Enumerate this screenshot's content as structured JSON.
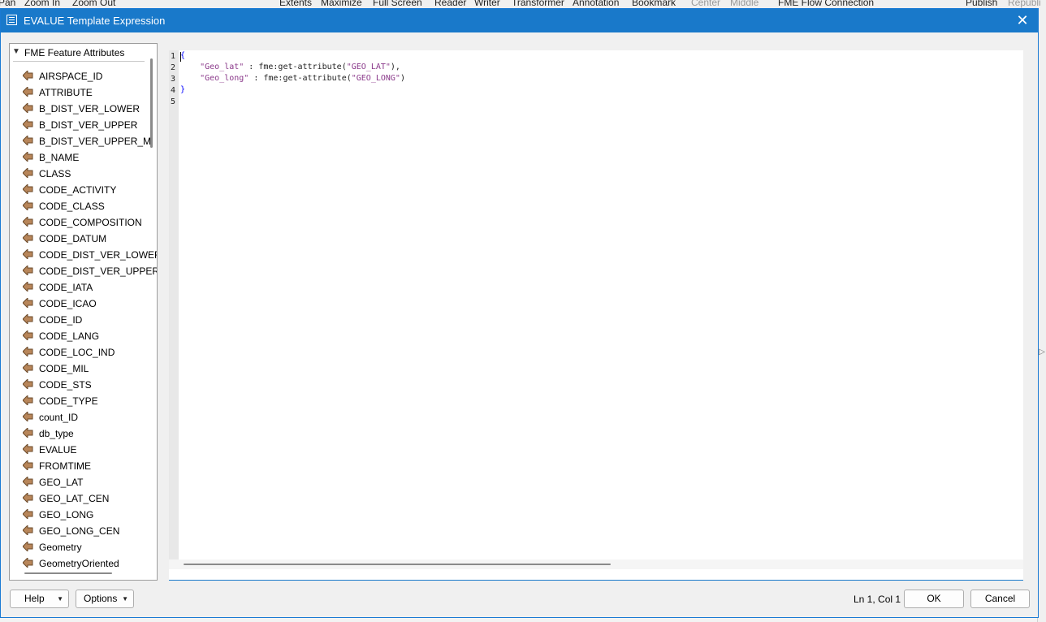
{
  "background_toolbar": {
    "items": [
      {
        "label": "Pan",
        "dim": false
      },
      {
        "label": "Zoom In",
        "dim": false
      },
      {
        "label": "Zoom Out",
        "dim": false
      },
      {
        "label": "Extents",
        "dim": false
      },
      {
        "label": "Maximize",
        "dim": false
      },
      {
        "label": "Full Screen",
        "dim": false
      },
      {
        "label": "Reader",
        "dim": false
      },
      {
        "label": "Writer",
        "dim": false
      },
      {
        "label": "Transformer",
        "dim": false
      },
      {
        "label": "Annotation",
        "dim": false
      },
      {
        "label": "Bookmark",
        "dim": false
      },
      {
        "label": "Center",
        "dim": true
      },
      {
        "label": "Middle",
        "dim": true
      },
      {
        "label": "FME Flow Connection",
        "dim": false
      },
      {
        "label": "Publish",
        "dim": false
      },
      {
        "label": "Republi",
        "dim": true
      }
    ]
  },
  "dialog": {
    "title": "EVALUE Template Expression",
    "close_glyph": "✕"
  },
  "tree": {
    "root_label": "FME Feature Attributes",
    "items": [
      "AIRSPACE_ID",
      "ATTRIBUTE",
      "B_DIST_VER_LOWER",
      "B_DIST_VER_UPPER",
      "B_DIST_VER_UPPER_M",
      "B_NAME",
      "CLASS",
      "CODE_ACTIVITY",
      "CODE_CLASS",
      "CODE_COMPOSITION",
      "CODE_DATUM",
      "CODE_DIST_VER_LOWER",
      "CODE_DIST_VER_UPPER",
      "CODE_IATA",
      "CODE_ICAO",
      "CODE_ID",
      "CODE_LANG",
      "CODE_LOC_IND",
      "CODE_MIL",
      "CODE_STS",
      "CODE_TYPE",
      "count_ID",
      "db_type",
      "EVALUE",
      "FROMTIME",
      "GEO_LAT",
      "GEO_LAT_CEN",
      "GEO_LONG",
      "GEO_LONG_CEN",
      "Geometry",
      "GeometryOriented"
    ],
    "icon": "attribute-arrow-icon",
    "icon_color": "#b8865a"
  },
  "editor": {
    "line_numbers": [
      "1",
      "2",
      "3",
      "4",
      "5"
    ],
    "lines": [
      [
        {
          "t": "{",
          "c": "brace"
        }
      ],
      [
        {
          "t": "    ",
          "c": ""
        },
        {
          "t": "\"Geo_lat\"",
          "c": "str"
        },
        {
          "t": " : fme:get-attribute(",
          "c": ""
        },
        {
          "t": "\"GEO_LAT\"",
          "c": "str"
        },
        {
          "t": "),",
          "c": ""
        }
      ],
      [
        {
          "t": "    ",
          "c": ""
        },
        {
          "t": "\"Geo_long\"",
          "c": "str"
        },
        {
          "t": " : fme:get-attribute(",
          "c": ""
        },
        {
          "t": "\"GEO_LONG\"",
          "c": "str"
        },
        {
          "t": ")",
          "c": ""
        }
      ],
      [
        {
          "t": "}",
          "c": "brace"
        }
      ],
      [
        {
          "t": "",
          "c": ""
        }
      ]
    ]
  },
  "footer": {
    "help_label": "Help",
    "options_label": "Options",
    "dropdown_glyph": "▼",
    "status": "Ln 1, Col 1",
    "ok_label": "OK",
    "cancel_label": "Cancel"
  },
  "colors": {
    "titlebar": "#1979ca",
    "string": "#8b3a8b",
    "brace": "#0000ff"
  }
}
